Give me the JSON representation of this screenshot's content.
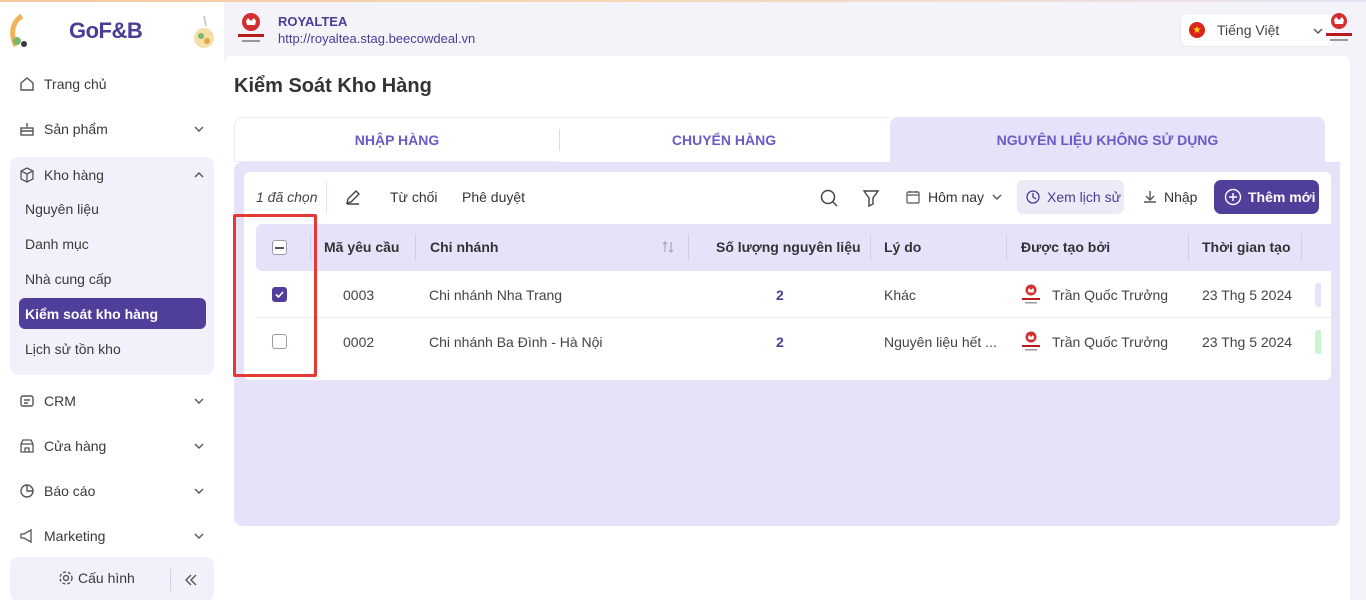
{
  "sidebar": {
    "logo": "GoF&B",
    "items": [
      {
        "label": "Trang chủ"
      },
      {
        "label": "Sản phẩm"
      },
      {
        "label": "Kho hàng"
      },
      {
        "label": "CRM"
      },
      {
        "label": "Cửa hàng"
      },
      {
        "label": "Báo cáo"
      },
      {
        "label": "Marketing"
      }
    ],
    "kho_sub": [
      {
        "label": "Nguyên liệu"
      },
      {
        "label": "Danh mục"
      },
      {
        "label": "Nhà cung cấp"
      },
      {
        "label": "Kiểm soát kho hàng"
      },
      {
        "label": "Lịch sử tồn kho"
      }
    ],
    "config_label": "Cấu hình"
  },
  "header": {
    "store_name": "ROYALTEA",
    "store_url": "http://royaltea.stag.beecowdeal.vn",
    "language": "Tiếng Việt"
  },
  "main": {
    "title": "Kiểm Soát Kho Hàng",
    "tabs": [
      {
        "label": "Nhập hàng"
      },
      {
        "label": "Chuyển hàng"
      },
      {
        "label": "Nguyên liệu không sử dụng"
      }
    ],
    "active_tab": 2
  },
  "toolbar": {
    "selected_count": "1 đã chọn",
    "reject": "Từ chối",
    "approve": "Phê duyệt",
    "date_filter": "Hôm nay",
    "history": "Xem lịch sử",
    "import": "Nhập",
    "add_new": "Thêm mới"
  },
  "table": {
    "columns": [
      "Mã yêu cầu",
      "Chi nhánh",
      "Số lượng nguyên liệu",
      "Lý do",
      "Được tạo bởi",
      "Thời gian tạo"
    ],
    "rows": [
      {
        "checked": true,
        "code": "0003",
        "branch": "Chi nhánh Nha Trang",
        "qty": "2",
        "reason": "Khác",
        "creator": "Trần Quốc Trưởng",
        "created": "23 Thg 5 2024"
      },
      {
        "checked": false,
        "code": "0002",
        "branch": "Chi nhánh Ba Đình - Hà Nội",
        "qty": "2",
        "reason": "Nguyên liệu hết ...",
        "creator": "Trần Quốc Trưởng",
        "created": "23 Thg 5 2024"
      }
    ]
  },
  "colors": {
    "brand": "#4f3f9b",
    "accent_light": "#e6e2fa",
    "highlight": "#e53935"
  }
}
